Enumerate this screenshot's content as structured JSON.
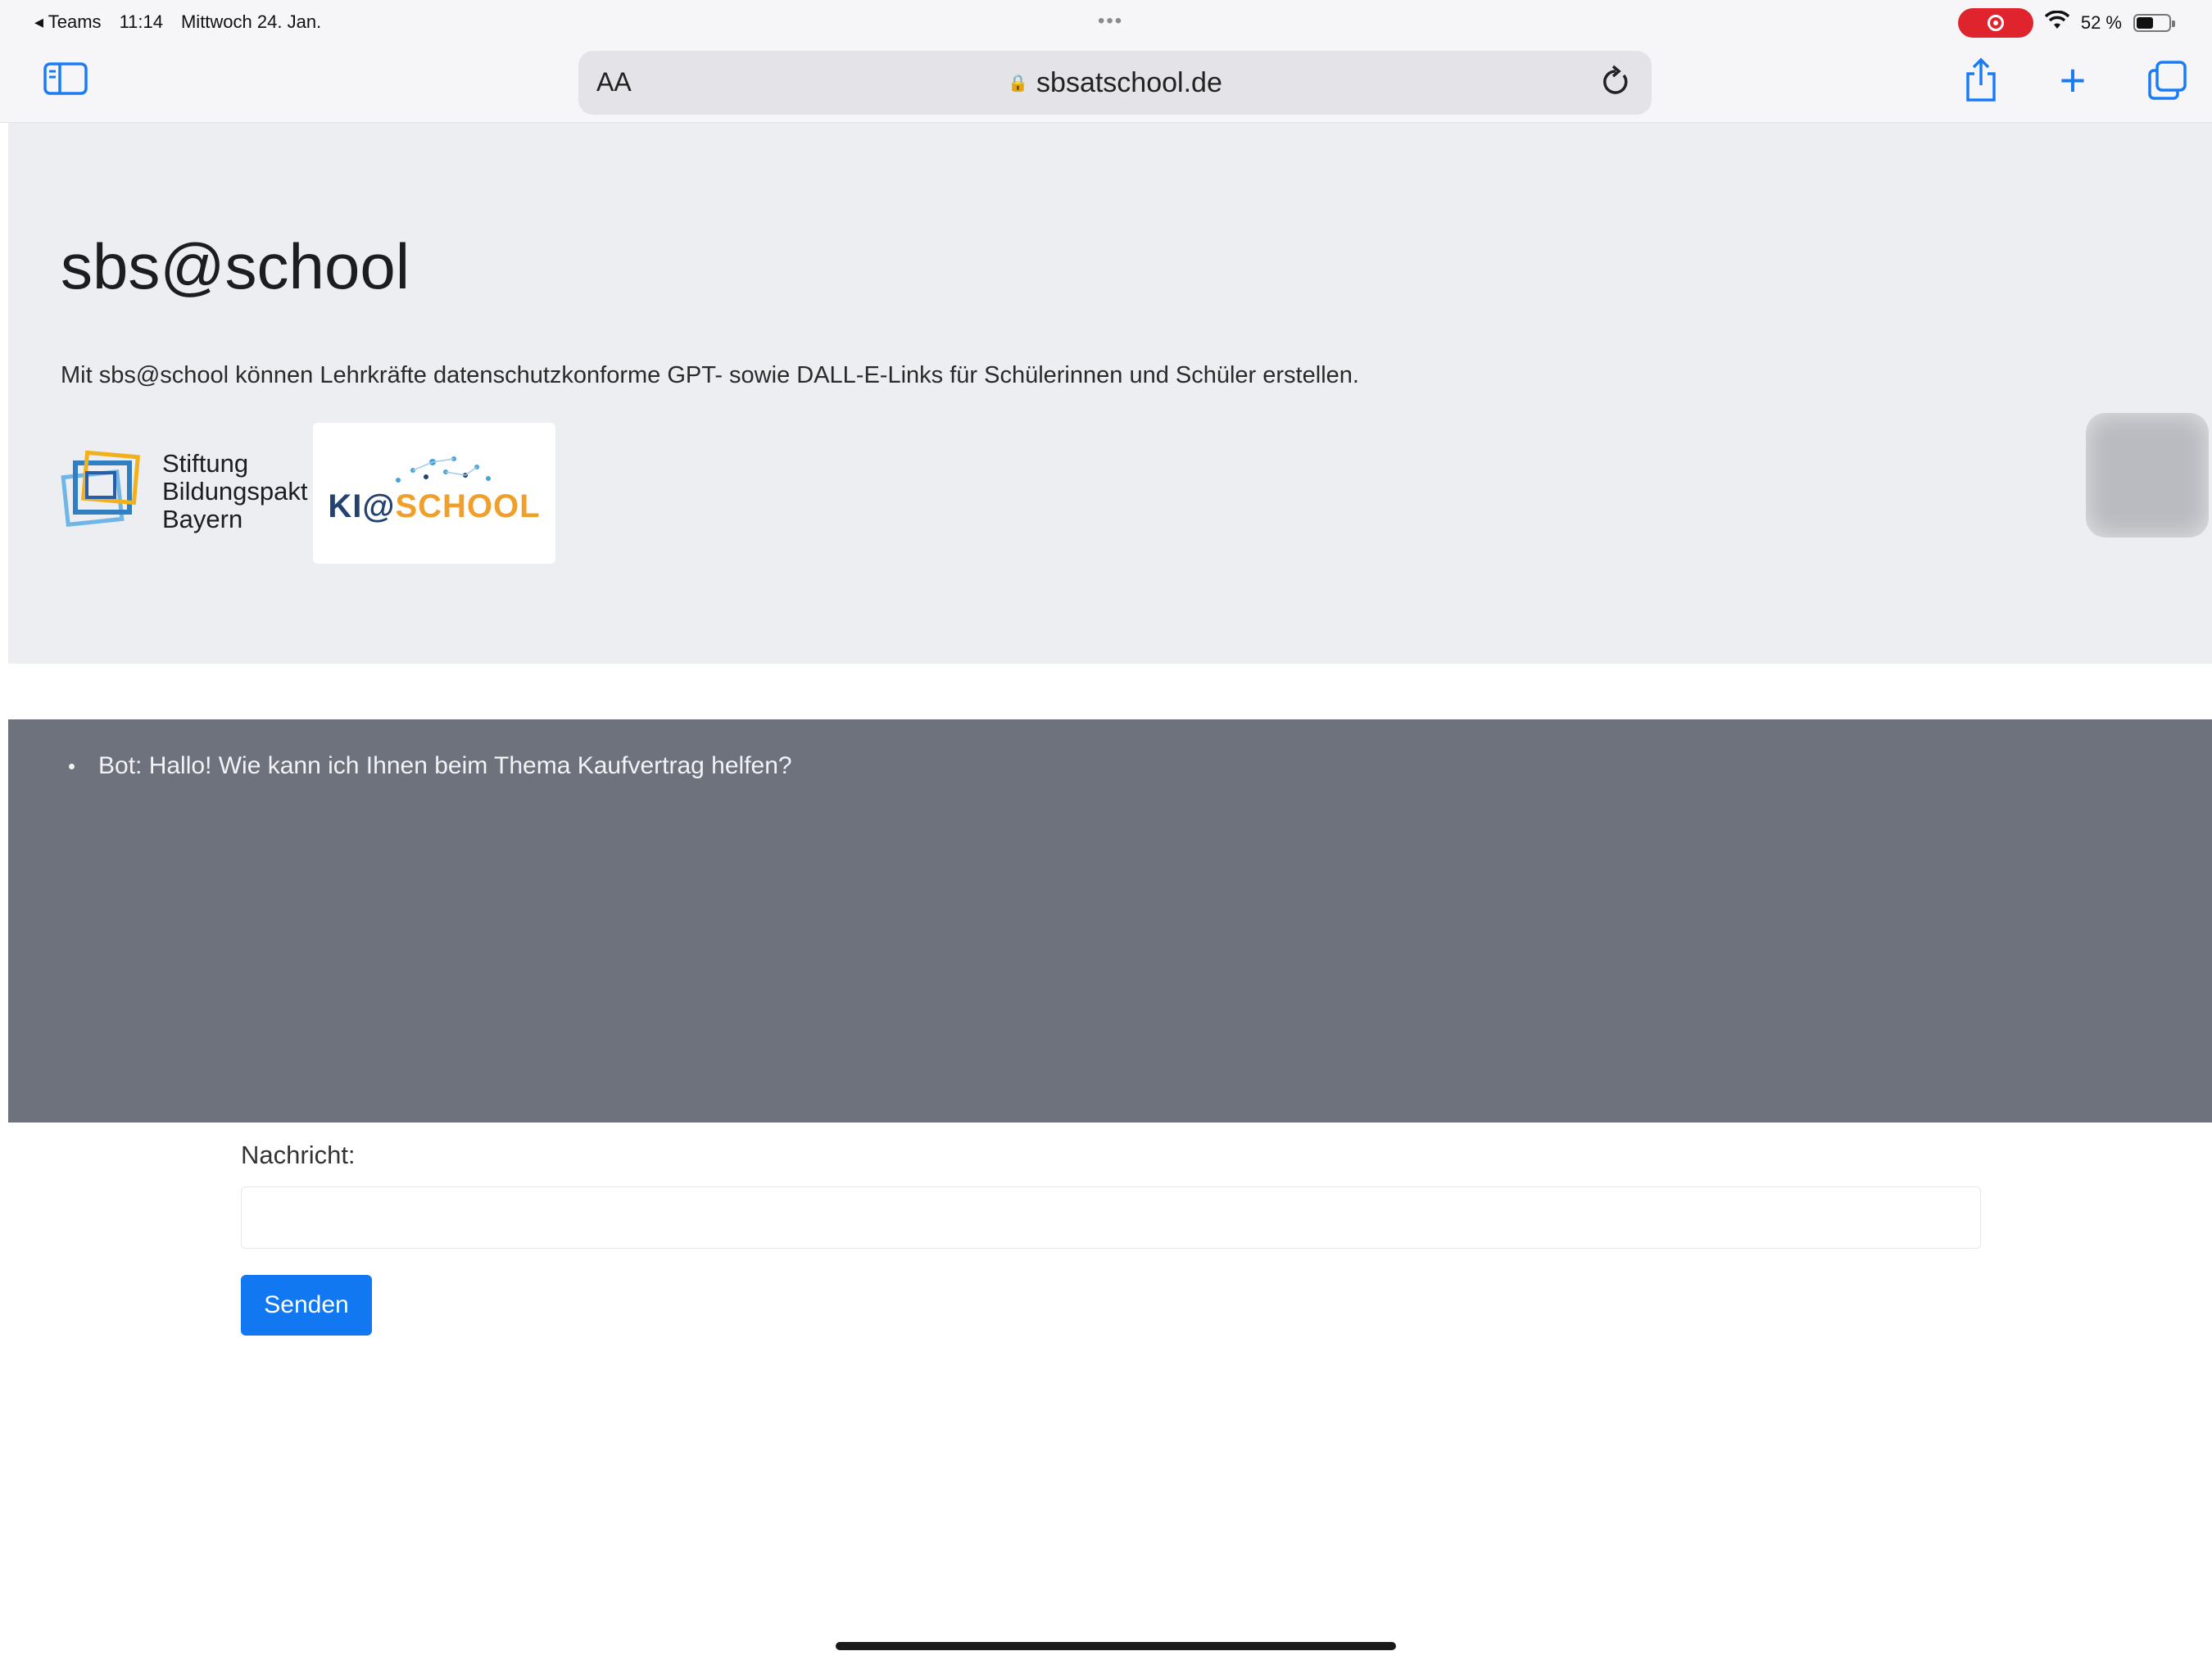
{
  "statusbar": {
    "back_app": "◂ Teams",
    "time": "11:14",
    "date": "Mittwoch 24. Jan.",
    "multitask_dots": "•••",
    "battery_text": "52 %",
    "battery_level": 0.52
  },
  "toolbar": {
    "text_size_label": "AA",
    "url": "sbsatschool.de"
  },
  "hero": {
    "title": "sbs@school",
    "description": "Mit sbs@school können Lehrkräfte datenschutzkonforme GPT- sowie DALL-E-Links für Schülerinnen und Schüler erstellen.",
    "logo_sbp": {
      "line1": "Stiftung",
      "line2": "Bildungspakt",
      "line3": "Bayern"
    },
    "logo_ki": {
      "part1": "KI@",
      "part2": "SCHOOL"
    }
  },
  "chat": {
    "messages": [
      "Bot: Hallo! Wie kann ich Ihnen beim Thema Kaufvertrag helfen?"
    ]
  },
  "form": {
    "label": "Nachricht:",
    "value": "",
    "send_label": "Senden"
  },
  "colors": {
    "accent": "#1178f2",
    "chat_bg": "#6d727d",
    "hero_bg": "#eceef2",
    "record": "#e0242d"
  }
}
